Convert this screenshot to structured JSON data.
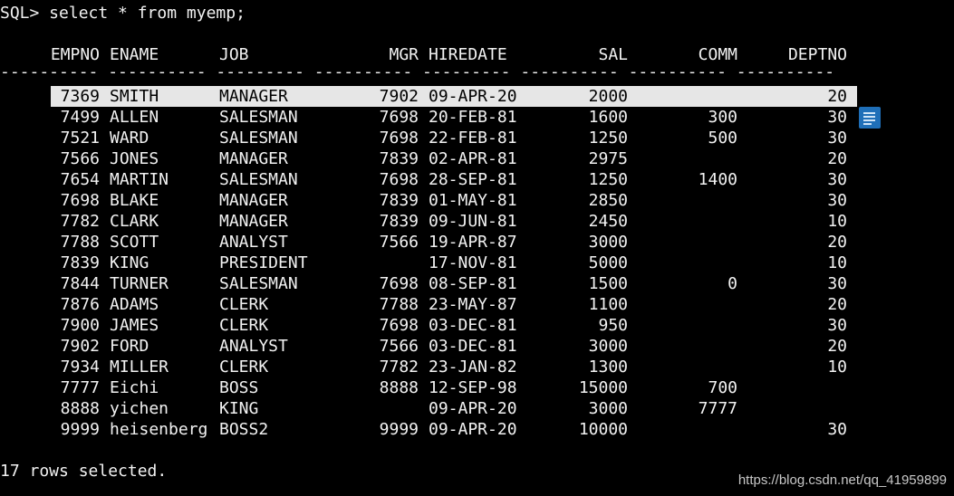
{
  "prompt_line": "SQL> select * from myemp;",
  "columns": {
    "empno": "EMPNO",
    "ename": "ENAME",
    "job": "JOB",
    "mgr": "MGR",
    "hiredate": "HIREDATE",
    "sal": "SAL",
    "comm": "COMM",
    "deptno": "DEPTNO"
  },
  "separator": "---------- ---------- --------- ---------- --------- ---------- ---------- ----------",
  "rows": [
    {
      "empno": "7369",
      "ename": "SMITH",
      "job": "MANAGER",
      "mgr": "7902",
      "hiredate": "09-APR-20",
      "sal": "2000",
      "comm": "",
      "deptno": "20"
    },
    {
      "empno": "7499",
      "ename": "ALLEN",
      "job": "SALESMAN",
      "mgr": "7698",
      "hiredate": "20-FEB-81",
      "sal": "1600",
      "comm": "300",
      "deptno": "30"
    },
    {
      "empno": "7521",
      "ename": "WARD",
      "job": "SALESMAN",
      "mgr": "7698",
      "hiredate": "22-FEB-81",
      "sal": "1250",
      "comm": "500",
      "deptno": "30"
    },
    {
      "empno": "7566",
      "ename": "JONES",
      "job": "MANAGER",
      "mgr": "7839",
      "hiredate": "02-APR-81",
      "sal": "2975",
      "comm": "",
      "deptno": "20"
    },
    {
      "empno": "7654",
      "ename": "MARTIN",
      "job": "SALESMAN",
      "mgr": "7698",
      "hiredate": "28-SEP-81",
      "sal": "1250",
      "comm": "1400",
      "deptno": "30"
    },
    {
      "empno": "7698",
      "ename": "BLAKE",
      "job": "MANAGER",
      "mgr": "7839",
      "hiredate": "01-MAY-81",
      "sal": "2850",
      "comm": "",
      "deptno": "30"
    },
    {
      "empno": "7782",
      "ename": "CLARK",
      "job": "MANAGER",
      "mgr": "7839",
      "hiredate": "09-JUN-81",
      "sal": "2450",
      "comm": "",
      "deptno": "10"
    },
    {
      "empno": "7788",
      "ename": "SCOTT",
      "job": "ANALYST",
      "mgr": "7566",
      "hiredate": "19-APR-87",
      "sal": "3000",
      "comm": "",
      "deptno": "20"
    },
    {
      "empno": "7839",
      "ename": "KING",
      "job": "PRESIDENT",
      "mgr": "",
      "hiredate": "17-NOV-81",
      "sal": "5000",
      "comm": "",
      "deptno": "10"
    },
    {
      "empno": "7844",
      "ename": "TURNER",
      "job": "SALESMAN",
      "mgr": "7698",
      "hiredate": "08-SEP-81",
      "sal": "1500",
      "comm": "0",
      "deptno": "30"
    },
    {
      "empno": "7876",
      "ename": "ADAMS",
      "job": "CLERK",
      "mgr": "7788",
      "hiredate": "23-MAY-87",
      "sal": "1100",
      "comm": "",
      "deptno": "20"
    },
    {
      "empno": "7900",
      "ename": "JAMES",
      "job": "CLERK",
      "mgr": "7698",
      "hiredate": "03-DEC-81",
      "sal": "950",
      "comm": "",
      "deptno": "30"
    },
    {
      "empno": "7902",
      "ename": "FORD",
      "job": "ANALYST",
      "mgr": "7566",
      "hiredate": "03-DEC-81",
      "sal": "3000",
      "comm": "",
      "deptno": "20"
    },
    {
      "empno": "7934",
      "ename": "MILLER",
      "job": "CLERK",
      "mgr": "7782",
      "hiredate": "23-JAN-82",
      "sal": "1300",
      "comm": "",
      "deptno": "10"
    },
    {
      "empno": "7777",
      "ename": "Eichi",
      "job": "BOSS",
      "mgr": "8888",
      "hiredate": "12-SEP-98",
      "sal": "15000",
      "comm": "700",
      "deptno": ""
    },
    {
      "empno": "8888",
      "ename": "yichen",
      "job": "KING",
      "mgr": "",
      "hiredate": "09-APR-20",
      "sal": "3000",
      "comm": "7777",
      "deptno": ""
    },
    {
      "empno": "9999",
      "ename": "heisenberg",
      "job": "BOSS2",
      "mgr": "9999",
      "hiredate": "09-APR-20",
      "sal": "10000",
      "comm": "",
      "deptno": "30"
    }
  ],
  "footer": "17 rows selected.",
  "watermark": "https://blog.csdn.net/qq_41959899",
  "colors": {
    "background": "#000000",
    "text": "#f2f2f2",
    "highlight": "#e6e6e6",
    "marker": "#1f6fb8"
  },
  "icons": {
    "scroll_marker": "document-lines-icon"
  }
}
